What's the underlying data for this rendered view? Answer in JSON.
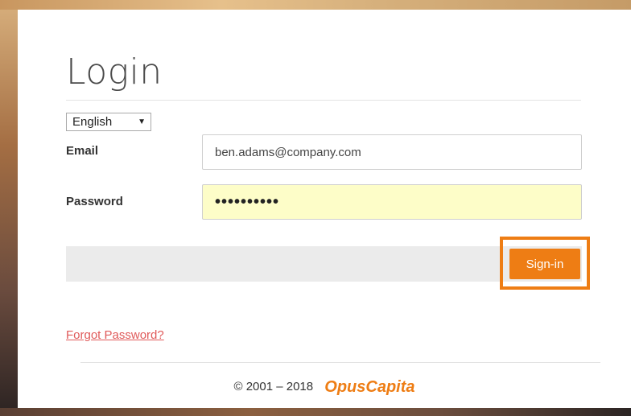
{
  "page": {
    "title": "Login"
  },
  "language": {
    "selected": "English"
  },
  "form": {
    "email_label": "Email",
    "email_value": "ben.adams@company.com",
    "password_label": "Password",
    "password_value": "••••••••••",
    "submit_label": "Sign-in"
  },
  "links": {
    "forgot_password": "Forgot Password?"
  },
  "footer": {
    "copyright": "© 2001 – 2018",
    "brand": "OpusCapita"
  },
  "colors": {
    "accent": "#ee7d14",
    "autofill_bg": "#fdfdc8",
    "link": "#e05a5a"
  },
  "icons": {
    "language_dropdown": "chevron-down-icon"
  }
}
